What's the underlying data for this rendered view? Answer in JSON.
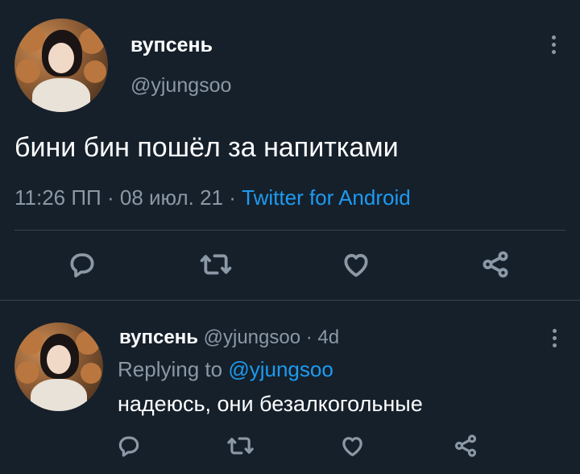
{
  "tweet": {
    "display_name": "вупсень",
    "handle": "@yjungsoo",
    "text": "бини бин пошёл за напитками",
    "time": "11:26 ПП",
    "date": "08 июл. 21",
    "separator": "·",
    "source": "Twitter for Android",
    "actions": [
      "reply-icon",
      "retweet-icon",
      "like-icon",
      "share-icon"
    ]
  },
  "reply": {
    "display_name": "вупсень",
    "handle": "@yjungsoo",
    "age": "4d",
    "separator": "·",
    "replying_label": "Replying to",
    "replying_to": "@yjungsoo",
    "text": "надеюсь, они безалкогольные"
  },
  "colors": {
    "background": "#15202b",
    "text": "#ffffff",
    "muted": "#8b98a5",
    "accent": "#1d9bf0",
    "divider": "#38444d"
  }
}
